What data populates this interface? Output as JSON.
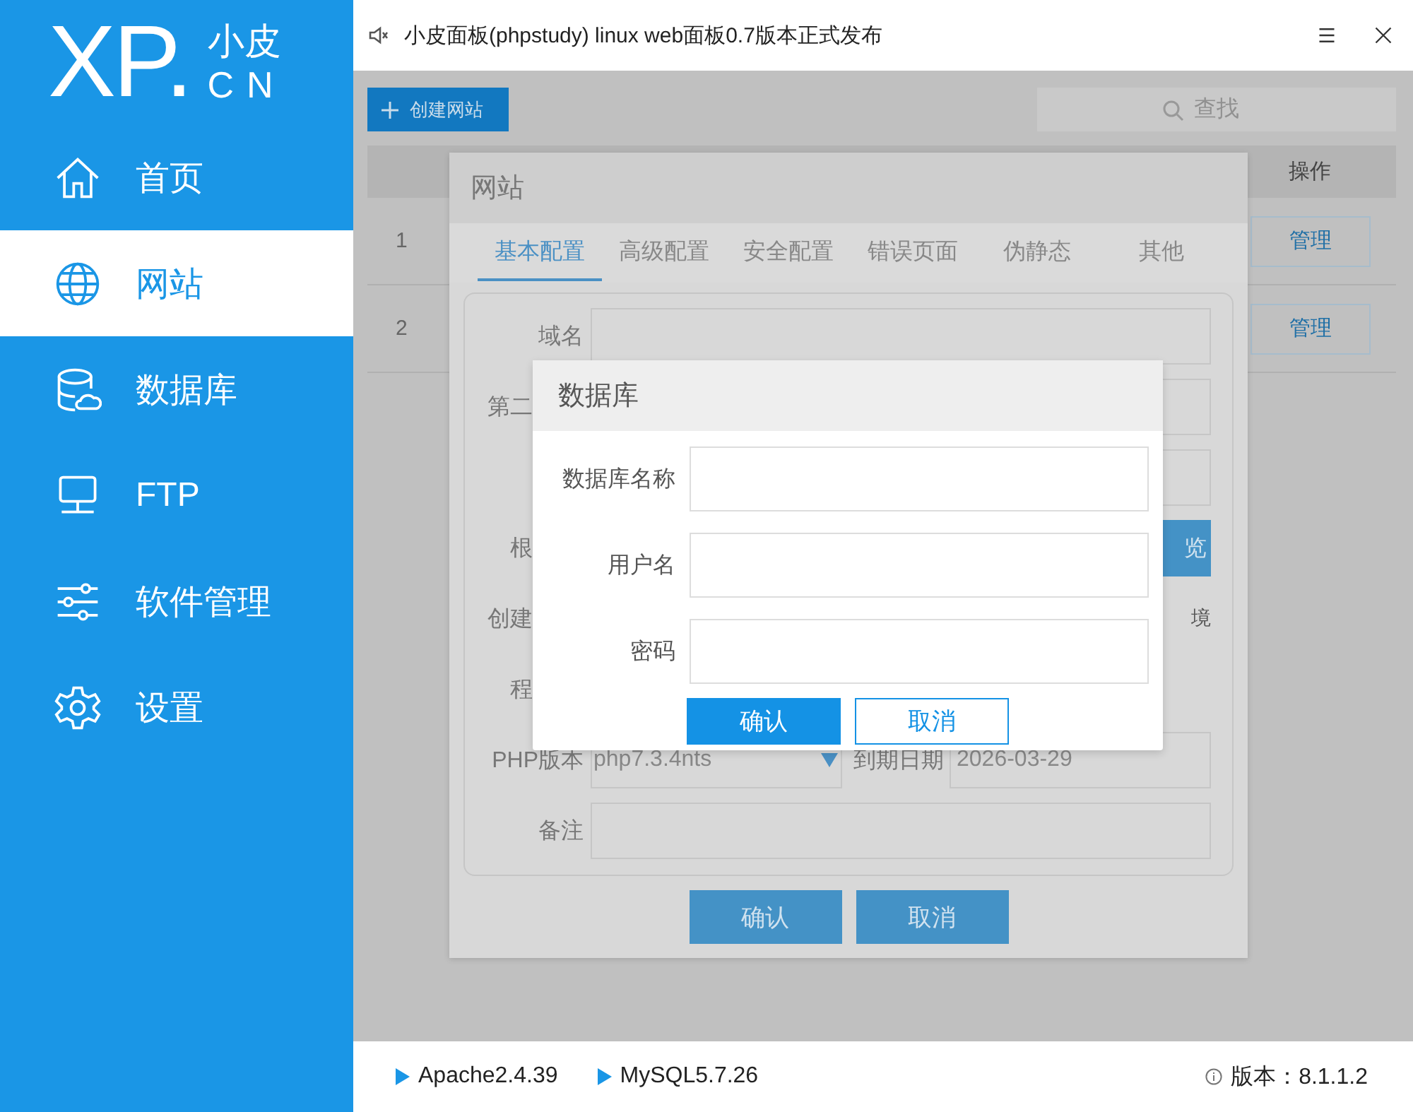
{
  "window": {
    "title": "小皮面板(phpstudy) linux web面板0.7版本正式发布"
  },
  "logo": {
    "mark": "XP.",
    "line1": "小皮",
    "line2": "CN"
  },
  "sidebar": {
    "items": [
      {
        "label": "首页",
        "kind": "home",
        "selected": false
      },
      {
        "label": "网站",
        "kind": "globe",
        "selected": true
      },
      {
        "label": "数据库",
        "kind": "database",
        "selected": false
      },
      {
        "label": "FTP",
        "kind": "monitor",
        "selected": false
      },
      {
        "label": "软件管理",
        "kind": "sliders",
        "selected": false
      },
      {
        "label": "设置",
        "kind": "gear",
        "selected": false
      }
    ]
  },
  "toolbar": {
    "create_button": "创建网站",
    "search": {
      "placeholder": "查找"
    }
  },
  "table": {
    "columns": [
      {
        "label": "操作"
      }
    ],
    "rows": [
      {
        "index": "1",
        "action": "管理"
      },
      {
        "index": "2",
        "action": "管理"
      }
    ]
  },
  "site_dialog": {
    "title": "网站",
    "tabs": [
      {
        "label": "基本配置",
        "selected": true
      },
      {
        "label": "高级配置",
        "selected": false
      },
      {
        "label": "安全配置",
        "selected": false
      },
      {
        "label": "错误页面",
        "selected": false
      },
      {
        "label": "伪静态",
        "selected": false
      },
      {
        "label": "其他",
        "selected": false
      }
    ],
    "form": {
      "domain_label": "域名",
      "second_label": "第二",
      "root_label": "根",
      "browse_button": "览",
      "create_label": "创建",
      "env_text": "境",
      "program_label": "程",
      "php_label": "PHP版本",
      "php_value": "php7.3.4nts",
      "expire_label": "到期日期",
      "expire_value": "2026-03-29",
      "note_label": "备注"
    },
    "buttons": [
      "确认",
      "取消"
    ]
  },
  "db_dialog": {
    "title": "数据库",
    "fields": [
      {
        "label": "数据库名称"
      },
      {
        "label": "用户名"
      },
      {
        "label": "密码"
      }
    ],
    "confirm": "确认",
    "cancel": "取消"
  },
  "status_bar": {
    "services": [
      "Apache2.4.39",
      "MySQL5.7.26"
    ],
    "version": "版本：8.1.1.2"
  }
}
